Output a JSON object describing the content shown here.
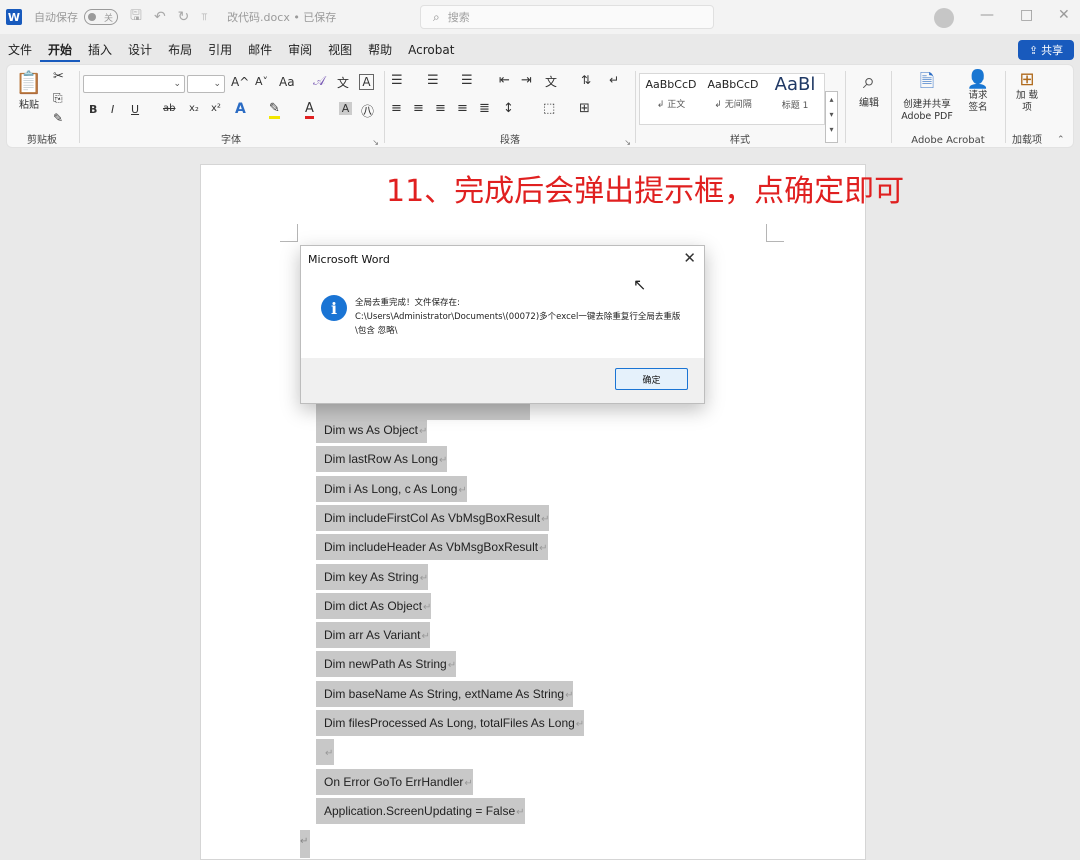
{
  "titlebar": {
    "app_icon": "word-icon",
    "autosave_label": "自动保存",
    "autosave_toggle": "关",
    "document_title": "改代码.docx • 已保存",
    "search_placeholder": "搜索"
  },
  "menu": {
    "items": [
      "文件",
      "开始",
      "插入",
      "设计",
      "布局",
      "引用",
      "邮件",
      "审阅",
      "视图",
      "帮助",
      "Acrobat"
    ],
    "active_index": 1,
    "share_label": "共享"
  },
  "ribbon": {
    "clipboard": {
      "paste_label": "粘贴",
      "group_label": "剪贴板"
    },
    "font": {
      "group_label": "字体",
      "grow": "A^",
      "shrink": "A˅",
      "change_case": "Aa",
      "bold": "B",
      "italic": "I",
      "underline": "U",
      "strike": "ab",
      "subscript": "x₂",
      "superscript": "x²"
    },
    "paragraph": {
      "group_label": "段落"
    },
    "styles": {
      "group_label": "样式",
      "items": [
        {
          "sample": "AaBbCcD",
          "name": "↲ 正文"
        },
        {
          "sample": "AaBbCcD",
          "name": "↲ 无间隔"
        },
        {
          "sample": "AaBl",
          "name": "标题 1"
        }
      ]
    },
    "editing": {
      "label": "编辑"
    },
    "acrobat": {
      "create_pdf": "创建并共享 Adobe PDF",
      "request_sign": "请求 签名",
      "group_label": "Adobe Acrobat"
    },
    "addins": {
      "label": "加 载项",
      "group_label": "加载项"
    }
  },
  "annotation": "11、完成后会弹出提示框，点确定即可",
  "code_lines": [
    "Dim ws As Object",
    "Dim lastRow As Long",
    "Dim i As Long, c As Long",
    "Dim includeFirstCol As VbMsgBoxResult",
    "Dim includeHeader As VbMsgBoxResult",
    "Dim key As String",
    "Dim dict As Object",
    "Dim arr As Variant",
    "Dim newPath As String",
    "Dim baseName As String, extName As String",
    "Dim filesProcessed As Long, totalFiles As Long",
    "",
    "On Error GoTo ErrHandler",
    "Application.ScreenUpdating = False"
  ],
  "paragraph_mark": "↵",
  "dialog": {
    "title": "Microsoft Word",
    "close": "✕",
    "message": "全局去重完成！文件保存在:\nC:\\Users\\Administrator\\Documents\\(00072)多个excel一键去除重复行全局去重版\\包含 忽略\\",
    "ok_label": "确定"
  }
}
